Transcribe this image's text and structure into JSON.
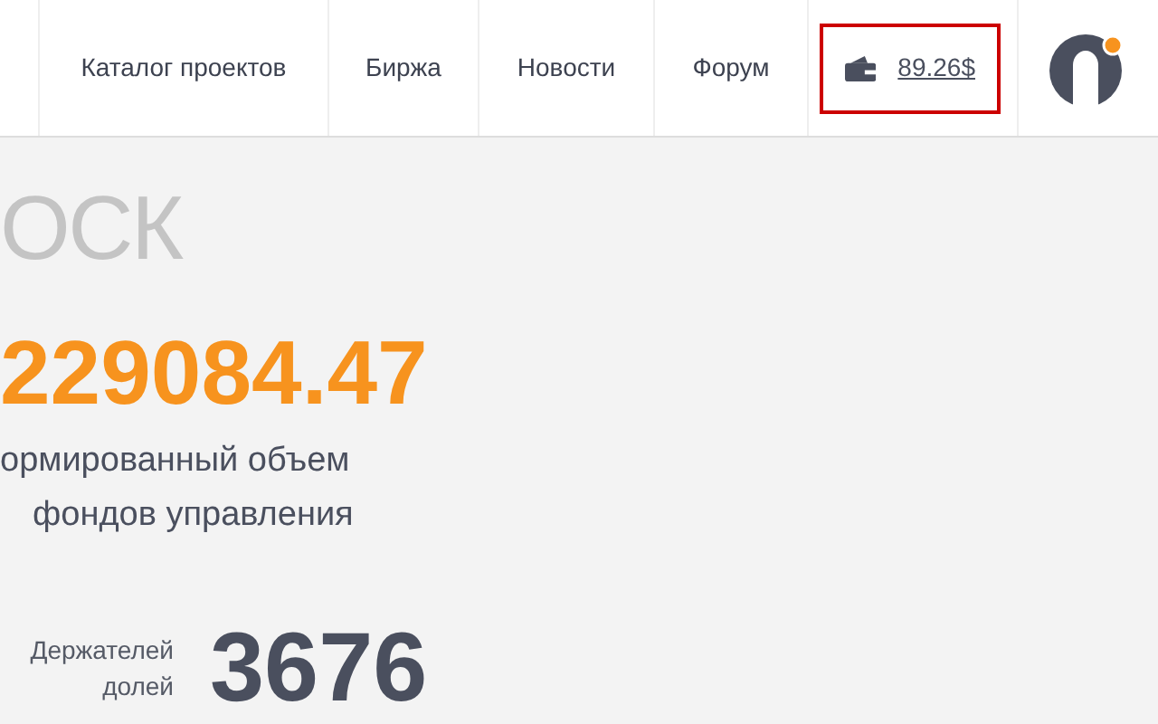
{
  "nav": {
    "items": [
      {
        "label": "Каталог проектов"
      },
      {
        "label": "Биржа"
      },
      {
        "label": "Новости"
      },
      {
        "label": "Форум"
      }
    ],
    "balance": "89.26$"
  },
  "hero": {
    "title": "ОСК",
    "amount": "229084.47",
    "caption": [
      "ормированный объем",
      "фондов управления"
    ]
  },
  "holders": {
    "label": "Держателей долей",
    "value": "3676"
  }
}
